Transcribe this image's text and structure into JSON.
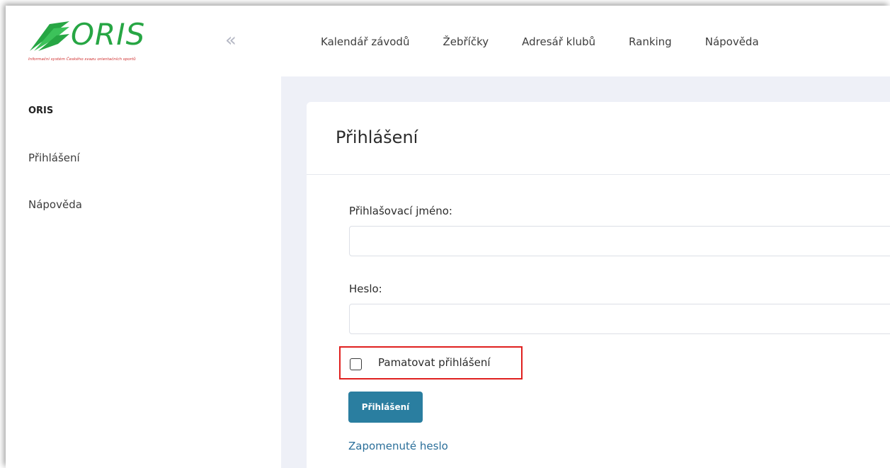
{
  "brand": {
    "name": "ORIS",
    "tagline": "Informační systém Českého svazu orientačních sportů",
    "color": "#27a644"
  },
  "sidebar": {
    "collapse_icon": "double-chevron-left-icon",
    "items": [
      {
        "label": "ORIS"
      },
      {
        "label": "Přihlášení"
      },
      {
        "label": "Nápověda"
      }
    ]
  },
  "topnav": {
    "items": [
      {
        "label": "Kalendář závodů"
      },
      {
        "label": "Žebříčky"
      },
      {
        "label": "Adresář klubů"
      },
      {
        "label": "Ranking"
      },
      {
        "label": "Nápověda"
      }
    ]
  },
  "login": {
    "title": "Přihlášení",
    "username_label": "Přihlašovací jméno:",
    "username_value": "",
    "password_label": "Heslo:",
    "password_value": "",
    "remember_label": "Pamatovat přihlášení",
    "remember_checked": false,
    "submit_label": "Přihlášení",
    "forgot_label": "Zapomenuté heslo",
    "accent": "#2a7ea0",
    "highlight_color": "#e0201f"
  }
}
